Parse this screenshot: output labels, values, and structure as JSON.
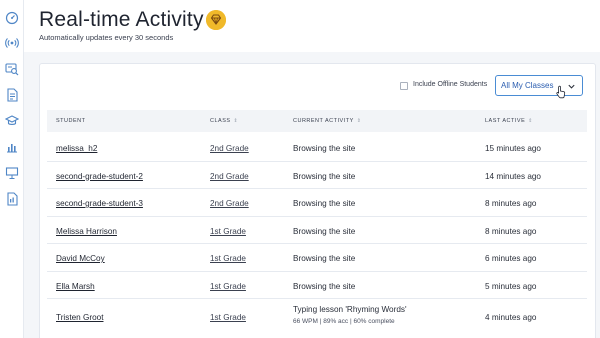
{
  "sidebar": {
    "icons": [
      "dashboard-icon",
      "live-broadcast-icon",
      "student-search-icon",
      "document-icon",
      "graduation-cap-icon",
      "bar-chart-icon",
      "presentation-icon",
      "report-icon"
    ]
  },
  "header": {
    "title": "Real-time Activity",
    "subtitle": "Automatically updates every 30 seconds",
    "badge_icon": "gem-icon",
    "badge_color": "#f0b92a"
  },
  "filters": {
    "offline_label": "Include Offline Students",
    "offline_checked": false,
    "class_select_value": "All My Classes"
  },
  "table": {
    "headers": {
      "student": "STUDENT",
      "class": "CLASS",
      "activity": "CURRENT ACTIVITY",
      "last_active": "LAST ACTIVE"
    },
    "rows": [
      {
        "student": "melissa_h2",
        "class": "2nd Grade",
        "activity": "Browsing the site",
        "detail": "",
        "last_active": "15 minutes ago"
      },
      {
        "student": "second-grade-student-2",
        "class": "2nd Grade",
        "activity": "Browsing the site",
        "detail": "",
        "last_active": "14 minutes ago"
      },
      {
        "student": "second-grade-student-3",
        "class": "2nd Grade",
        "activity": "Browsing the site",
        "detail": "",
        "last_active": "8 minutes ago"
      },
      {
        "student": "Melissa Harrison",
        "class": "1st Grade",
        "activity": "Browsing the site",
        "detail": "",
        "last_active": "8 minutes ago"
      },
      {
        "student": "David McCoy",
        "class": "1st Grade",
        "activity": "Browsing the site",
        "detail": "",
        "last_active": "6 minutes ago"
      },
      {
        "student": "Ella Marsh",
        "class": "1st Grade",
        "activity": "Browsing the site",
        "detail": "",
        "last_active": "5 minutes ago"
      },
      {
        "student": "Tristen Groot",
        "class": "1st Grade",
        "activity": "Typing lesson 'Rhyming Words'",
        "detail": "66 WPM | 89% acc | 60% complete",
        "last_active": "4 minutes ago"
      }
    ]
  },
  "colors": {
    "accent": "#4a8cd4",
    "sidebar_icon": "#4f86c6"
  }
}
